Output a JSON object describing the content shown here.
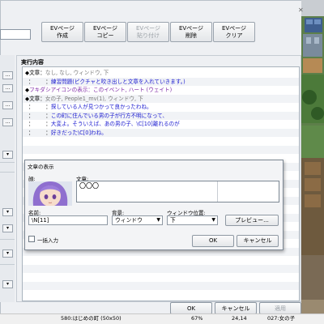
{
  "toolbar": {
    "buttons": [
      {
        "label": "EVページ\n作成",
        "enabled": true
      },
      {
        "label": "EVページ\nコピー",
        "enabled": true
      },
      {
        "label": "EVページ\n貼り付け",
        "enabled": false
      },
      {
        "label": "EVページ\n削除",
        "enabled": true
      },
      {
        "label": "EVページ\nクリア",
        "enabled": true
      }
    ]
  },
  "left_panel": {
    "ellipsis": "…"
  },
  "content": {
    "label": "実行内容",
    "lines": [
      {
        "marker": "◆",
        "head": "文章：",
        "text": "なし, なし, ウィンドウ, 下",
        "style": "gray"
      },
      {
        "marker": "：",
        "head": "：",
        "text": "練習問題(ピクチャと吹き出しと文章を入れていきます。)",
        "style": "blue"
      },
      {
        "marker": "◆",
        "head": "フキダシアイコンの表示：",
        "text": "このイベント, ハート (ウェイト)",
        "style": "purple"
      },
      {
        "marker": "◆",
        "head": "文章：",
        "text": "女の子, People1_mv(1), ウィンドウ, 下",
        "style": "gray"
      },
      {
        "marker": "：",
        "head": "：",
        "text": "探している人が見つかって良かったわね。",
        "style": "blue"
      },
      {
        "marker": "：",
        "head": "：",
        "text": "この町に住んでいる男の子が行方不明になって、",
        "style": "blue"
      },
      {
        "marker": "：",
        "head": "：",
        "text": "大変よ。そういえば、あの男の子、\\C[10]離れるのが",
        "style": "blue"
      },
      {
        "marker": "：",
        "head": "：",
        "text": "好きだった\\C[0]わね。",
        "style": "blue"
      }
    ]
  },
  "dialog": {
    "title": "文章の表示",
    "face_label": "顔:",
    "text_label": "文章:",
    "text_value": "〇〇〇",
    "name_label": "名前:",
    "name_value": "\\N[11]",
    "background_label": "背景:",
    "background_value": "ウィンドウ",
    "position_label": "ウィンドウ位置:",
    "position_value": "下",
    "preview_label": "プレビュー...",
    "batch_label": "一括入力",
    "ok_label": "OK",
    "cancel_label": "キャンセル"
  },
  "bottom": {
    "ok_label": "OK",
    "cancel_label": "キャンセル",
    "apply_label": "適用"
  },
  "statusbar": {
    "map": "580:はじめの町 (50x50)",
    "zoom": "67%",
    "coords": "24,14",
    "event": "027:女の子"
  },
  "colors": {
    "blue_text": "#1b1bd0",
    "purple_text": "#7f2aa6",
    "hair": "#8f6fcf"
  }
}
